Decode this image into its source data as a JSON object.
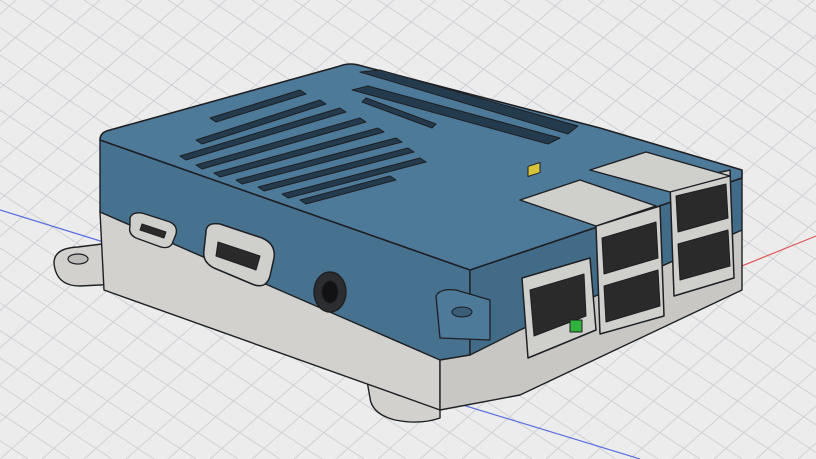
{
  "viewport": {
    "background": "#ececed",
    "grid_color": "#cfd1d4",
    "axis_x_color": "#e05a5a",
    "axis_y_color": "#5a6fe0"
  },
  "model": {
    "case_top_color": "#4e7a9a",
    "case_top_side_color": "#46718f",
    "case_bottom_color": "#d3d1cd",
    "outline_color": "#1d1f22",
    "port_metal_color": "#cfcfcc",
    "led_green": "#2fb33c",
    "led_yellow": "#d7c43d"
  },
  "icons": [
    "micro-usb-port-icon",
    "hdmi-port-icon",
    "audio-jack-icon",
    "ethernet-port-icon",
    "usb-port-icon",
    "mounting-tab-icon",
    "vent-slot-icon"
  ]
}
